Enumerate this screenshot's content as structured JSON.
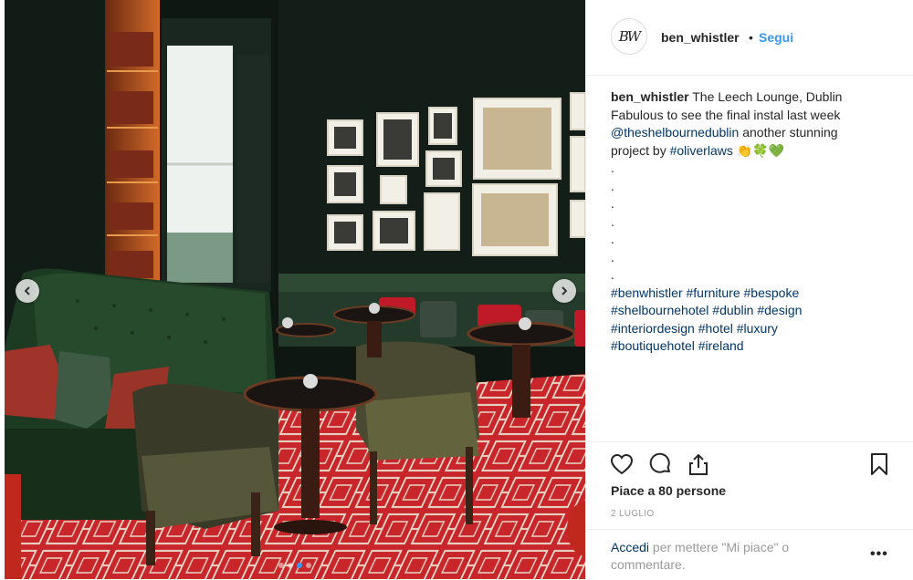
{
  "post": {
    "username": "ben_whistler",
    "separator": "•",
    "follow_label": "Segui",
    "avatar_text": "BW"
  },
  "caption": {
    "username": "ben_whistler",
    "line1": " The Leech Lounge, Dublin",
    "line2": "Fabulous to see the final instal last week",
    "mention": "@theshelbournedublin",
    "line3_rest": " another stunning",
    "line4_start": "project by ",
    "hashtag_oliverlaws": "#oliverlaws",
    "emojis": " 👏🍀💚",
    "dots": ".\n.\n.\n.\n.\n.\n.",
    "hashtags_line1": "#benwhistler #furniture #bespoke",
    "hashtags_line2": "#shelbournehotel #dublin #design",
    "hashtags_line3": "#interiordesign #hotel #luxury",
    "hashtags_line4": "#boutiquehotel #ireland"
  },
  "actions": {
    "like_icon": "heart-icon",
    "comment_icon": "comment-icon",
    "share_icon": "share-icon",
    "save_icon": "bookmark-icon"
  },
  "likes_text": "Piace a 80 persone",
  "date_text": "2 LUGLIO",
  "footer": {
    "login_link": "Accedi",
    "login_rest": " per mettere \"Mi piace\" o commentare.",
    "more_label": "•••"
  },
  "carousel": {
    "prev_icon": "chevron-left-icon",
    "next_icon": "chevron-right-icon",
    "dot_count": 4,
    "active_index": 2
  }
}
